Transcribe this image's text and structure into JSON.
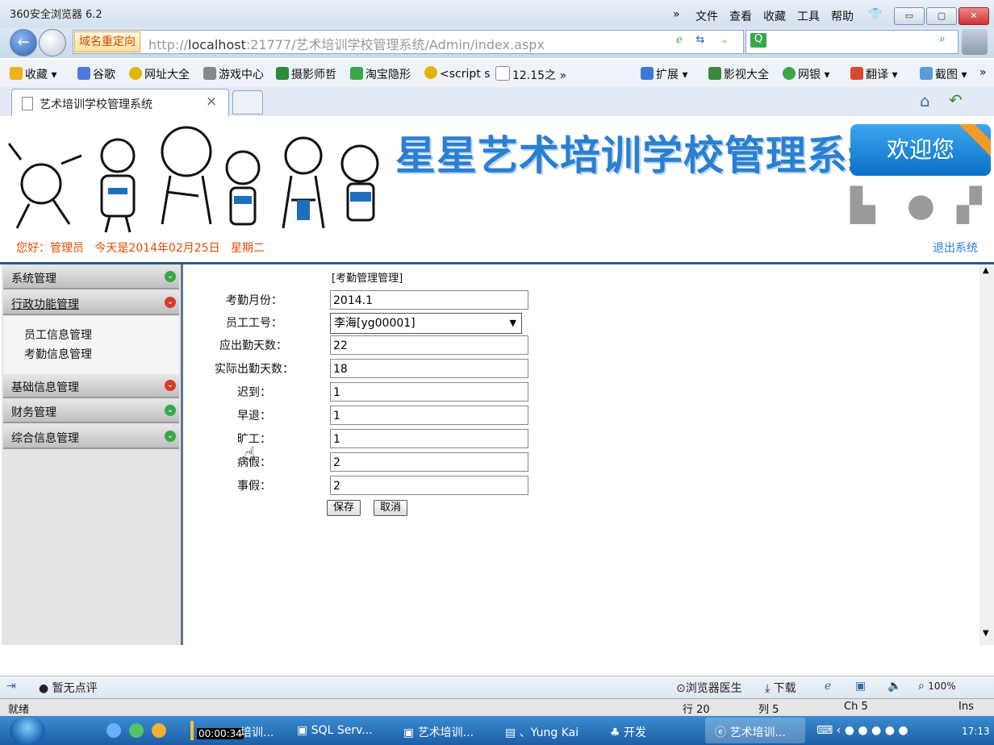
{
  "browser": {
    "title": "360安全浏览器 6.2",
    "menu": [
      "文件",
      "查看",
      "收藏",
      "工具",
      "帮助"
    ],
    "redirect_label": "域名重定向",
    "url_prefix": "http://",
    "url_host": "localhost",
    "url_rest": ":21777/艺术培训学校管理系统/Admin/index.aspx",
    "favorites": [
      "收藏",
      "谷歌",
      "网址大全",
      "游戏中心",
      "摄影师哲",
      "淘宝隐形",
      "<script s",
      "12.15之"
    ],
    "right_tools": [
      "扩展",
      "影视大全",
      "网银",
      "翻译",
      "截图"
    ],
    "tab_title": "艺术培训学校管理系统",
    "tab_close": "×"
  },
  "header": {
    "system_name": "星星艺术培训学校管理系统",
    "welcome": "欢迎您",
    "greeting": "您好：管理员   今天是2014年02月25日   星期二",
    "logout": "退出系统"
  },
  "sidebar": {
    "sections": [
      {
        "label": "系统管理",
        "state": "collapsed"
      },
      {
        "label": "行政功能管理",
        "state": "expanded"
      },
      {
        "label": "基础信息管理",
        "state": "collapsed"
      },
      {
        "label": "财务管理",
        "state": "collapsed"
      },
      {
        "label": "综合信息管理",
        "state": "collapsed"
      }
    ],
    "sub_items": [
      "员工信息管理",
      "考勤信息管理"
    ]
  },
  "form": {
    "title": "[考勤管理管理]",
    "labels": {
      "month": "考勤月份：",
      "employee": "员工工号：",
      "expected": "应出勤天数：",
      "actual": "实际出勤天数：",
      "late": "迟到：",
      "early": "早退：",
      "absent": "旷工：",
      "sick": "病假：",
      "personal": "事假："
    },
    "values": {
      "month": "2014.1",
      "employee": "李海[yg00001]",
      "expected": "22",
      "actual": "18",
      "late": "1",
      "early": "1",
      "absent": "1",
      "sick": "2",
      "personal": "2"
    },
    "save": "保存",
    "cancel": "取消"
  },
  "statusbar": {
    "comment": "暂无点评",
    "doctor": "浏览器医生",
    "download": "下载",
    "zoom": "100%",
    "ready": "就绪",
    "row": "行 20",
    "col": "列 5",
    "ch": "Ch 5",
    "ins": "Ins"
  },
  "taskbar": {
    "timer": "00:00:34",
    "items": [
      "培训...",
      "SQL Serv...",
      "艺术培训...",
      "、Yung Kai",
      "开发",
      "艺术培训..."
    ],
    "clock": "17:13"
  }
}
